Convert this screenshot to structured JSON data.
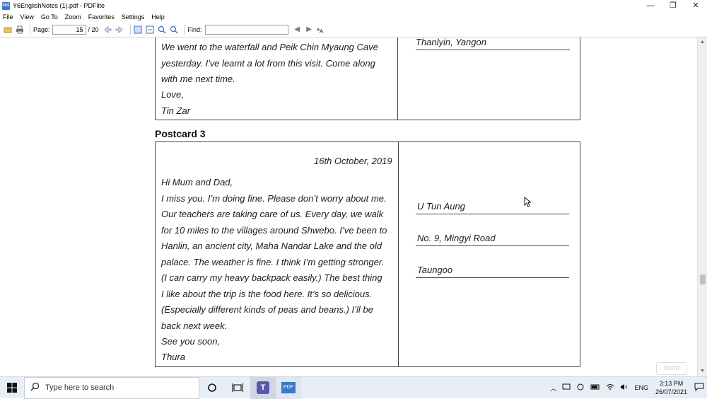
{
  "window": {
    "title": "Y6EnglishNotes (1).pdf - PDFlite",
    "app_icon": "PDF",
    "minimize": "—",
    "maximize": "❐",
    "close": "✕"
  },
  "menu": [
    "File",
    "View",
    "Go To",
    "Zoom",
    "Favorites",
    "Settings",
    "Help"
  ],
  "toolbar": {
    "page_label": "Page:",
    "page_value": "15",
    "page_total": "/ 20",
    "find_label": "Find:",
    "find_value": ""
  },
  "document": {
    "postcard2": {
      "lines": [
        "We went to the waterfall and Peik Chin Myaung Cave",
        "yesterday. I've leamt a lot from this visit. Come along",
        "with me next time.",
        "Love,",
        "Tin Zar"
      ],
      "address_last": "Thanlyin, Yangon"
    },
    "postcard3": {
      "heading": "Postcard 3",
      "date": "16th October, 2019",
      "lines": [
        "Hi Mum and Dad,",
        "I miss you. I’m doing fine. Please don’t worry about me.",
        "Our teachers are taking care of us. Every day, we walk",
        "for 10 miles to the villages around Shwebo. I’ve been to",
        "Hanlin, an ancient city, Maha Nandar Lake and the old",
        "palace. The weather is fine. I think I’m getting stronger.",
        "(I can carry my heavy backpack easily.) The best thing",
        "I like about the trip is the food here. It’s so delicious.",
        "(Especially different kinds of peas and beans.) I’ll be",
        "back next week.",
        "See you soon,",
        "Thura"
      ],
      "address": [
        "U Tun Aung",
        "No. 9, Mingyi Road",
        "Taungoo"
      ]
    }
  },
  "taskbar": {
    "search_placeholder": "Type here to search",
    "language": "ENG",
    "time": "3:13 PM",
    "date": "26/07/2021",
    "teams_label": "T",
    "pdf_label": "PDF"
  },
  "watermark": "loom"
}
